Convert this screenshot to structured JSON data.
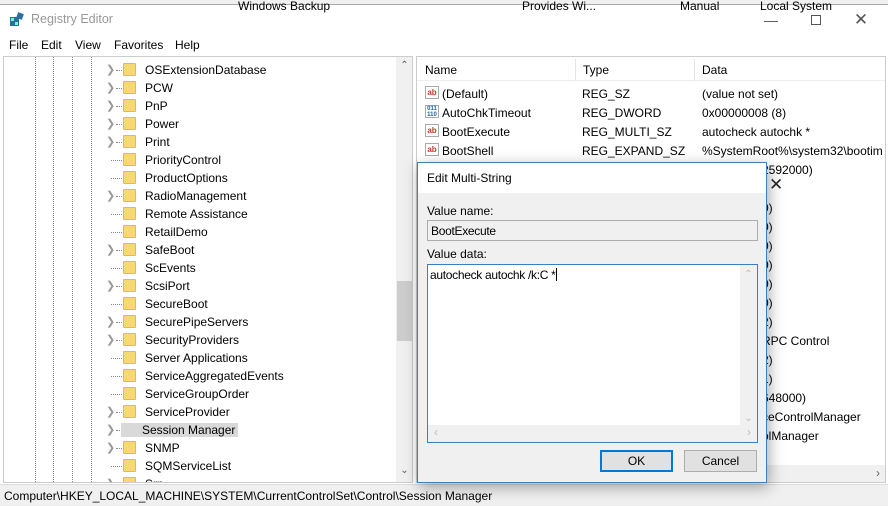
{
  "background": {
    "top_row": [
      "Windows Backup",
      "Provides Wi...",
      "Manual",
      "Local System"
    ]
  },
  "window": {
    "title": "Registry Editor",
    "icon": "registry-editor-icon",
    "controls": [
      "minimize-icon",
      "maximize-icon",
      "close-icon"
    ]
  },
  "menu": [
    "File",
    "Edit",
    "View",
    "Favorites",
    "Help"
  ],
  "tree": {
    "items": [
      {
        "label": "OSExtensionDatabase",
        "expandable": true
      },
      {
        "label": "PCW",
        "expandable": true
      },
      {
        "label": "PnP",
        "expandable": true
      },
      {
        "label": "Power",
        "expandable": true
      },
      {
        "label": "Print",
        "expandable": true
      },
      {
        "label": "PriorityControl",
        "expandable": false
      },
      {
        "label": "ProductOptions",
        "expandable": false
      },
      {
        "label": "RadioManagement",
        "expandable": true
      },
      {
        "label": "Remote Assistance",
        "expandable": false
      },
      {
        "label": "RetailDemo",
        "expandable": false
      },
      {
        "label": "SafeBoot",
        "expandable": true
      },
      {
        "label": "ScEvents",
        "expandable": false
      },
      {
        "label": "ScsiPort",
        "expandable": true
      },
      {
        "label": "SecureBoot",
        "expandable": false
      },
      {
        "label": "SecurePipeServers",
        "expandable": true
      },
      {
        "label": "SecurityProviders",
        "expandable": true
      },
      {
        "label": "Server Applications",
        "expandable": false
      },
      {
        "label": "ServiceAggregatedEvents",
        "expandable": false
      },
      {
        "label": "ServiceGroupOrder",
        "expandable": false
      },
      {
        "label": "ServiceProvider",
        "expandable": true
      },
      {
        "label": "Session Manager",
        "expandable": true,
        "selected": true
      },
      {
        "label": "SNMP",
        "expandable": true
      },
      {
        "label": "SQMServiceList",
        "expandable": false
      },
      {
        "label": "Srp",
        "expandable": true
      }
    ]
  },
  "list": {
    "columns": [
      "Name",
      "Type",
      "Data"
    ],
    "rows": [
      {
        "icon": "string-value-icon",
        "name": "(Default)",
        "type": "REG_SZ",
        "data": "(value not set)"
      },
      {
        "icon": "binary-value-icon",
        "name": "AutoChkTimeout",
        "type": "REG_DWORD",
        "data": "0x00000008 (8)"
      },
      {
        "icon": "string-value-icon",
        "name": "BootExecute",
        "type": "REG_MULTI_SZ",
        "data": "autocheck autochk *"
      },
      {
        "icon": "string-value-icon",
        "name": "BootShell",
        "type": "REG_EXPAND_SZ",
        "data": "%SystemRoot%\\system32\\bootim"
      }
    ],
    "partial_data": [
      "2592000)",
      "",
      "0)",
      "0)",
      "0)",
      "0)",
      "0)",
      "0)",
      "2)",
      "RPC Control",
      "2)",
      "1)",
      "648000)",
      "ceControlManager",
      "olManager"
    ]
  },
  "status": "Computer\\HKEY_LOCAL_MACHINE\\SYSTEM\\CurrentControlSet\\Control\\Session Manager",
  "dialog": {
    "title": "Edit Multi-String",
    "value_name_label": "Value name:",
    "value_name": "BootExecute",
    "value_data_label": "Value data:",
    "value_data": "autocheck autochk /k:C *",
    "ok": "OK",
    "cancel": "Cancel"
  }
}
